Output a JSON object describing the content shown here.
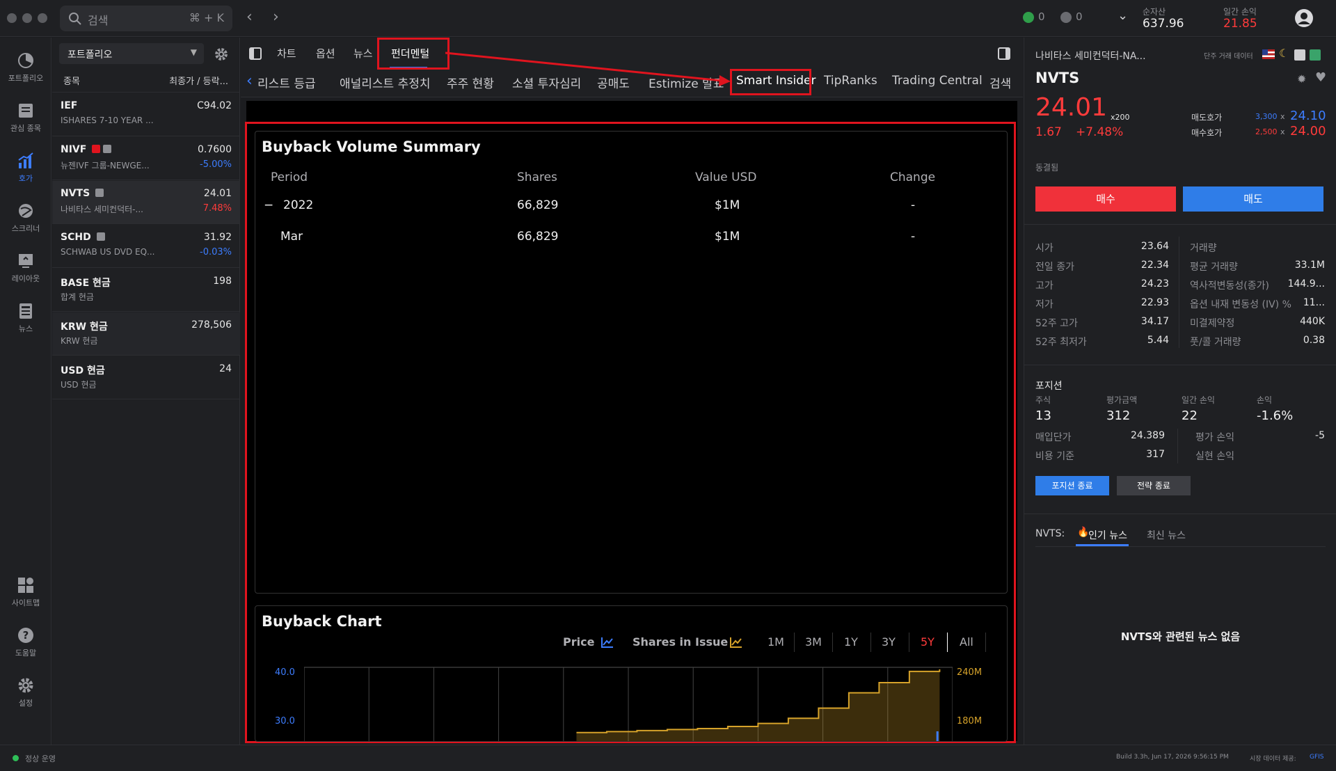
{
  "topbar": {
    "search_placeholder": "검색",
    "search_shortcut": "⌘ + K",
    "alerts_count": "0",
    "checks_count": "0",
    "net_assets_label": "순자산",
    "net_assets_value": "637.96",
    "daily_pl_label": "일간 손익",
    "daily_pl_value": "21.85"
  },
  "rail": {
    "items": [
      {
        "label": "포트폴리오",
        "icon": "portfolio-icon"
      },
      {
        "label": "관심 종목",
        "icon": "watchlist-icon"
      },
      {
        "label": "호가",
        "icon": "quote-icon"
      },
      {
        "label": "스크리너",
        "icon": "screener-icon"
      },
      {
        "label": "레이아웃",
        "icon": "layout-icon"
      },
      {
        "label": "뉴스",
        "icon": "news-icon"
      },
      {
        "label": "사이트맵",
        "icon": "sitemap-icon"
      },
      {
        "label": "도움말",
        "icon": "help-icon"
      },
      {
        "label": "설정",
        "icon": "settings-icon"
      }
    ]
  },
  "portfolio": {
    "selector_label": "포트폴리오",
    "header_left": "종목",
    "header_right": "최종가 / 등락...",
    "rows": [
      {
        "symbol": "IEF",
        "name": "ISHARES 7-10 YEAR ...",
        "price": "C94.02",
        "change": ""
      },
      {
        "symbol": "NIVF",
        "name": "뉴젠IVF 그룹-NEWGE...",
        "price": "0.7600",
        "change": "-5.00%",
        "change_color": "#3d7dff"
      },
      {
        "symbol": "NVTS",
        "name": "나비타스 세미컨덕터-...",
        "price": "24.01",
        "change": "7.48%",
        "change_color": "#ff3b3b"
      },
      {
        "symbol": "SCHD",
        "name": "SCHWAB US DVD EQ...",
        "price": "31.92",
        "change": "-0.03%",
        "change_color": "#3d7dff"
      },
      {
        "symbol": "BASE 현금",
        "name": "합계 현금",
        "price": "198",
        "change": ""
      },
      {
        "symbol": "KRW 현금",
        "name": "KRW 현금",
        "price": "278,506",
        "change": ""
      },
      {
        "symbol": "USD 현금",
        "name": "USD 현금",
        "price": "24",
        "change": ""
      }
    ]
  },
  "tabs_main": [
    "차트",
    "옵션",
    "뉴스",
    "펀더멘털"
  ],
  "tabs_sub": [
    "리스트 등급",
    "애널리스트 추정치",
    "주주 현황",
    "소셜 투자심리",
    "공매도",
    "Estimize 발표",
    "Smart Insider",
    "TipRanks",
    "Trading Central",
    "검색"
  ],
  "summary": {
    "title": "Buyback Volume Summary",
    "columns": [
      "Period",
      "Shares",
      "Value USD",
      "Change"
    ],
    "rows": [
      {
        "toggle": "−",
        "period": "2022",
        "shares": "66,829",
        "value": "$1M",
        "change": "-"
      },
      {
        "toggle": "",
        "period": "Mar",
        "shares": "66,829",
        "value": "$1M",
        "change": "-"
      }
    ]
  },
  "buyback_chart": {
    "title": "Buyback Chart",
    "legend_price": "Price",
    "legend_shares": "Shares in Issue",
    "ranges": [
      "1M",
      "3M",
      "1Y",
      "3Y",
      "5Y",
      "All"
    ],
    "active_range": "5Y"
  },
  "chart_data": {
    "type": "line",
    "title": "Buyback Chart",
    "y_left_ticks": [
      "40.0",
      "30.0"
    ],
    "y_right_ticks": [
      "240M",
      "180M"
    ],
    "series": [
      {
        "name": "Shares in Issue",
        "values": [
          176,
          177,
          178,
          179,
          180,
          182,
          185,
          190,
          200,
          215,
          225,
          236,
          238
        ]
      }
    ],
    "grid": true
  },
  "quote": {
    "name": "나비타스 세미컨덕터-NA...",
    "extra_label": "단주 거래 데이터",
    "symbol": "NVTS",
    "price": "24.01",
    "multiplier": "x200",
    "change": "1.67",
    "change_pct": "+7.48%",
    "ask_label": "매도호가",
    "ask_size": "3,300",
    "ask_price": "24.10",
    "bid_label": "매수호가",
    "bid_size": "2,500",
    "bid_price": "24.00",
    "x": "x",
    "status": "동결됨",
    "buy_label": "매수",
    "sell_label": "매도",
    "stats_left": [
      {
        "label": "시가",
        "value": "23.64"
      },
      {
        "label": "전일 종가",
        "value": "22.34"
      },
      {
        "label": "고가",
        "value": "24.23"
      },
      {
        "label": "저가",
        "value": "22.93"
      },
      {
        "label": "52주 고가",
        "value": "34.17"
      },
      {
        "label": "52주 최저가",
        "value": "5.44"
      }
    ],
    "stats_right": [
      {
        "label": "거래량",
        "value": ""
      },
      {
        "label": "평균 거래량",
        "value": "33.1M"
      },
      {
        "label": "역사적변동성(종가)",
        "value": "144.9..."
      },
      {
        "label": "옵션 내재 변동성 (IV) %",
        "value": "11..."
      },
      {
        "label": "미결제약정",
        "value": "440K"
      },
      {
        "label": "풋/콜 거래량",
        "value": "0.38"
      }
    ]
  },
  "position": {
    "title": "포지션",
    "cols": [
      {
        "label": "주식",
        "value": "13"
      },
      {
        "label": "평가금액",
        "value": "312"
      },
      {
        "label": "일간 손익",
        "value": "22"
      },
      {
        "label": "손익",
        "value": "-1.6%"
      }
    ],
    "avg_cost_label": "매입단가",
    "avg_cost_value": "24.389",
    "cost_basis_label": "비용 기준",
    "cost_basis_value": "317",
    "unrealized_label": "평가 손익",
    "unrealized_value": "-5",
    "realized_label": "실현 손익",
    "realized_value": "",
    "close_position": "포지션 종료",
    "close_strategy": "전략 종료"
  },
  "news": {
    "prefix": "NVTS:",
    "tab_hot": "인기 뉴스",
    "tab_latest": "최신 뉴스",
    "empty": "NVTS와 관련된 뉴스 없음"
  },
  "statusbar": {
    "status": "정상 운영",
    "build": "Build 3.3h, Jun 17, 2026 9:56:15 PM",
    "provider_label": "시장 데이터 제공:",
    "provider": "GFIS"
  }
}
